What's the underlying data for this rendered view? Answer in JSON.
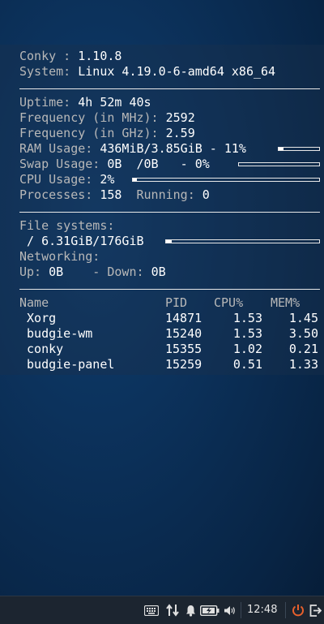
{
  "conky": {
    "version_label": "Conky : ",
    "version_value": "1.10.8",
    "system_label": "System: ",
    "system_value": "Linux 4.19.0-6-amd64 x86_64",
    "uptime_label": "Uptime: ",
    "uptime_value": "4h 52m 40s",
    "freq_mhz_label": "Frequency (in MHz): ",
    "freq_mhz_value": "2592",
    "freq_ghz_label": "Frequency (in GHz): ",
    "freq_ghz_value": "2.59",
    "ram_label": "RAM Usage: ",
    "ram_value": "436MiB/3.85GiB - 11%",
    "ram_fraction": 0.11,
    "swap_label": "Swap Usage: ",
    "swap_value": "0B  /0B   - 0%",
    "swap_fraction": 0.0,
    "cpu_label": "CPU Usage: ",
    "cpu_value": "2%",
    "cpu_fraction": 0.02,
    "processes_label": "Processes: ",
    "processes_value": "158",
    "running_label": "  Running: ",
    "running_value": "0",
    "fs_label": "File systems:",
    "fs_root_value": " / 6.31GiB/176GiB",
    "fs_fraction": 0.036,
    "networking_label": "Networking:",
    "up_label": "Up: ",
    "up_value": "0B",
    "down_label": "    - Down: ",
    "down_value": "0B",
    "proc_table": {
      "headers": [
        "Name",
        "PID",
        "CPU%",
        "MEM%"
      ],
      "rows": [
        [
          " Xorg",
          "14871",
          "1.53",
          "1.45"
        ],
        [
          " budgie-wm",
          "15240",
          "1.53",
          "3.50"
        ],
        [
          " conky",
          "15355",
          "1.02",
          "0.21"
        ],
        [
          " budgie-panel",
          "15259",
          "0.51",
          "1.33"
        ]
      ]
    }
  },
  "taskbar": {
    "clock": "12:48",
    "icons": [
      "keyboard-icon",
      "network-transfer-icon",
      "notification-bell-icon",
      "battery-icon",
      "volume-icon",
      "power-icon",
      "logout-icon"
    ]
  }
}
